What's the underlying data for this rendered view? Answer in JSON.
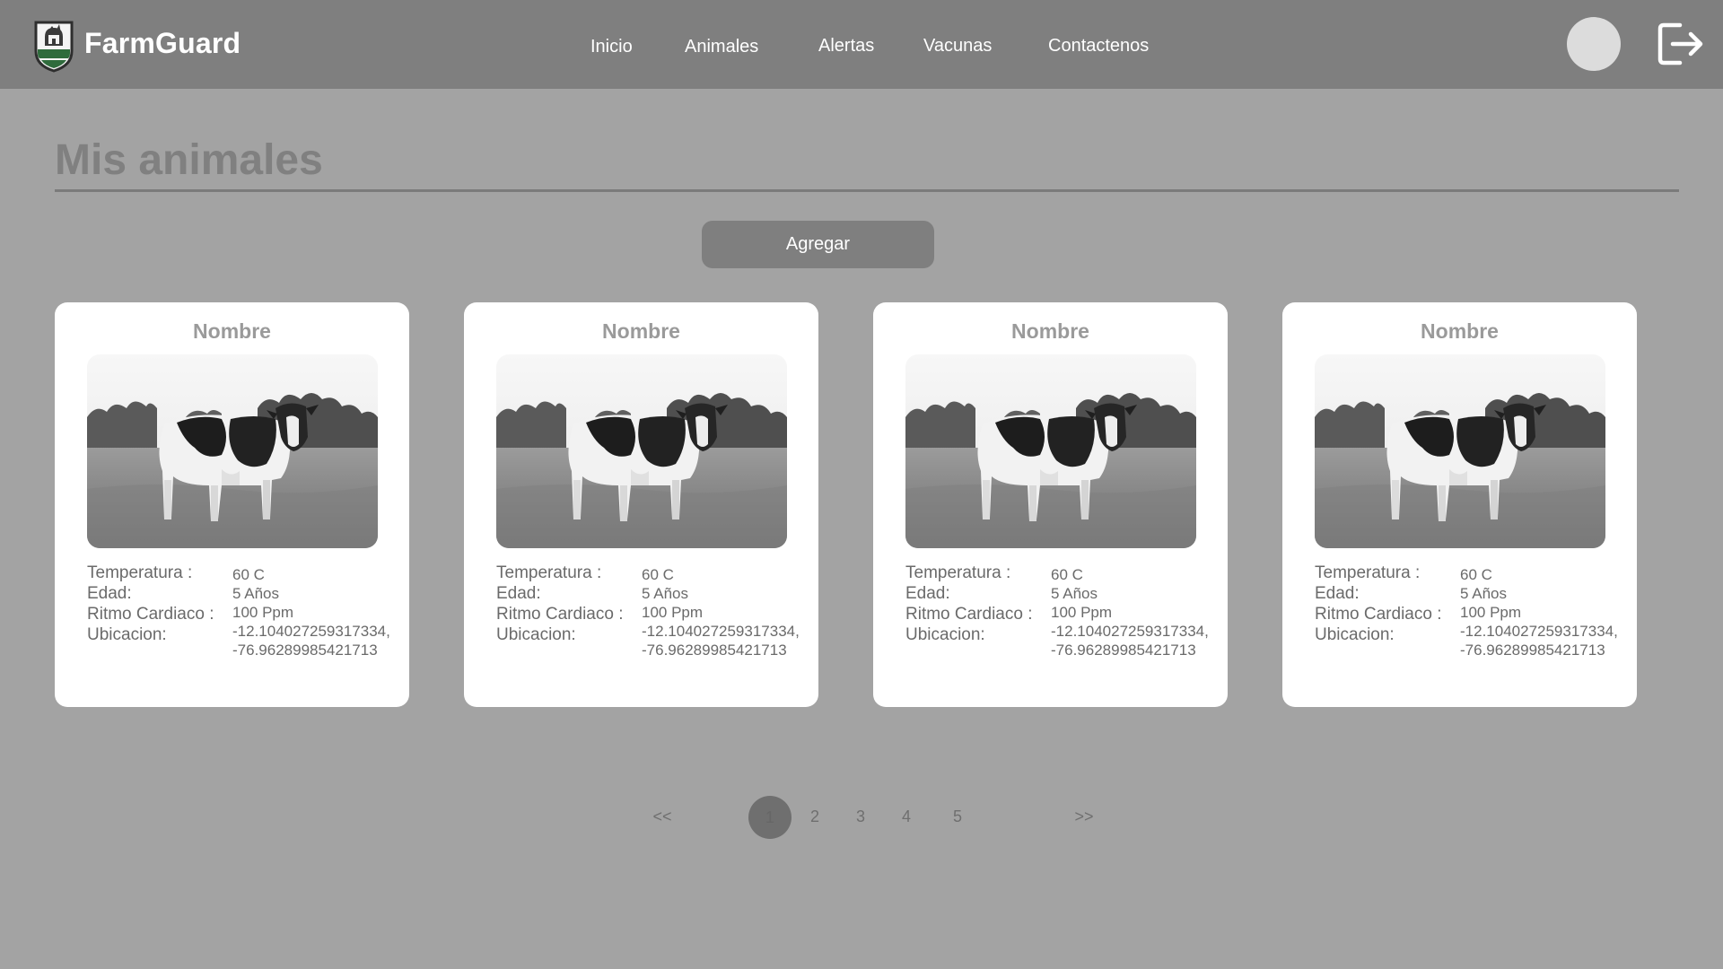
{
  "header": {
    "brand": "FarmGuard",
    "logo_icon": "farm-shield-logo-icon",
    "nav": [
      {
        "label": "Inicio"
      },
      {
        "label": "Animales"
      },
      {
        "label": "Alertas"
      },
      {
        "label": "Vacunas"
      },
      {
        "label": "Contactenos"
      }
    ],
    "avatar_icon": "user-avatar",
    "logout_icon": "logout-icon"
  },
  "main": {
    "title": "Mis animales",
    "add_label": "Agregar",
    "field_labels": {
      "temperature": "Temperatura :",
      "age": "Edad:",
      "heart_rate": "Ritmo Cardiaco :",
      "location": "Ubicacion:"
    },
    "cards": [
      {
        "name": "Nombre",
        "temperature": "60 C",
        "age": "5 Años",
        "heart_rate": "100 Ppm",
        "lat": "-12.104027259317334,",
        "lng": "-76.96289985421713"
      },
      {
        "name": "Nombre",
        "temperature": "60 C",
        "age": "5 Años",
        "heart_rate": "100 Ppm",
        "lat": "-12.104027259317334,",
        "lng": "-76.96289985421713"
      },
      {
        "name": "Nombre",
        "temperature": "60 C",
        "age": "5 Años",
        "heart_rate": "100 Ppm",
        "lat": "-12.104027259317334,",
        "lng": "-76.96289985421713"
      },
      {
        "name": "Nombre",
        "temperature": "60 C",
        "age": "5 Años",
        "heart_rate": "100 Ppm",
        "lat": "-12.104027259317334,",
        "lng": "-76.96289985421713"
      }
    ]
  },
  "pagination": {
    "prev": "<<",
    "pages": [
      "1",
      "2",
      "3",
      "4",
      "5"
    ],
    "current": "1",
    "next": ">>"
  },
  "colors": {
    "background": "#a3a3a3",
    "header": "#7f7f7f",
    "card": "#ffffff",
    "button": "#7f7f7f"
  }
}
